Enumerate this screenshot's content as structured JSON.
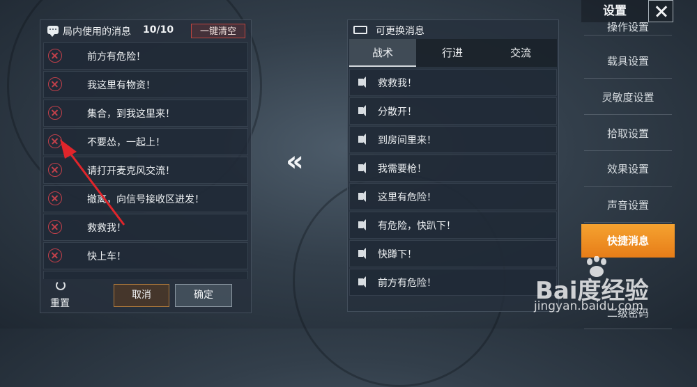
{
  "left_panel": {
    "title": "局内使用的消息",
    "count": "10/10",
    "clear_label": "一键清空",
    "messages": [
      "前方有危险！",
      "我这里有物资！",
      "集合，到我这里来！",
      "不要怂，一起上！",
      "请打开麦克风交流！",
      "撤离，向信号接收区进发！",
      "救救我！",
      "快上车！"
    ],
    "reset_label": "重置",
    "cancel_label": "取消",
    "confirm_label": "确定"
  },
  "right_panel": {
    "title": "可更换消息",
    "tabs": [
      "战术",
      "行进",
      "交流"
    ],
    "active_tab": "战术",
    "messages": [
      "救救我！",
      "分散开！",
      "到房间里来！",
      "我需要枪！",
      "这里有危险！",
      "有危险，快趴下！",
      "快蹲下！",
      "前方有危险！"
    ]
  },
  "sidebar": {
    "title": "设置",
    "items": [
      "操作设置",
      "载具设置",
      "灵敏度设置",
      "拾取设置",
      "效果设置",
      "声音设置",
      "快捷消息",
      "二级密码"
    ],
    "active_item": "快捷消息"
  },
  "icons": {
    "chevrons": "double-chevron-left-icon",
    "chevrons_text": "«"
  },
  "watermark": {
    "logo": "Bai度经验",
    "url": "jingyan.baidu.com"
  },
  "colors": {
    "accent_orange": "#f39a2b",
    "remove_red": "#c2404a",
    "annotation_red": "#e0252b"
  }
}
